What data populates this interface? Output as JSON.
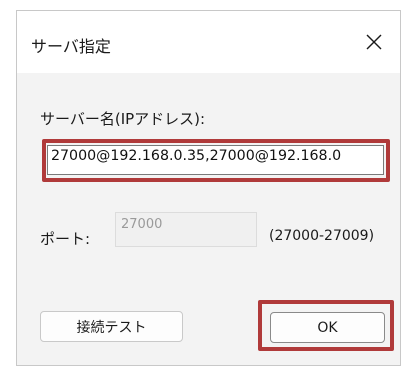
{
  "window": {
    "title": "サーバ指定",
    "close_icon": "close-icon"
  },
  "server": {
    "label": "サーバー名(IPアドレス):",
    "value": "27000@192.168.0.35,27000@192.168.0"
  },
  "port": {
    "label": "ポート:",
    "placeholder": "27000",
    "range": "(27000-27009)"
  },
  "buttons": {
    "test_label": "接続テスト",
    "ok_label": "OK"
  },
  "colors": {
    "highlight": "#b03a3a",
    "dialog_bg": "#f3f3f3"
  }
}
